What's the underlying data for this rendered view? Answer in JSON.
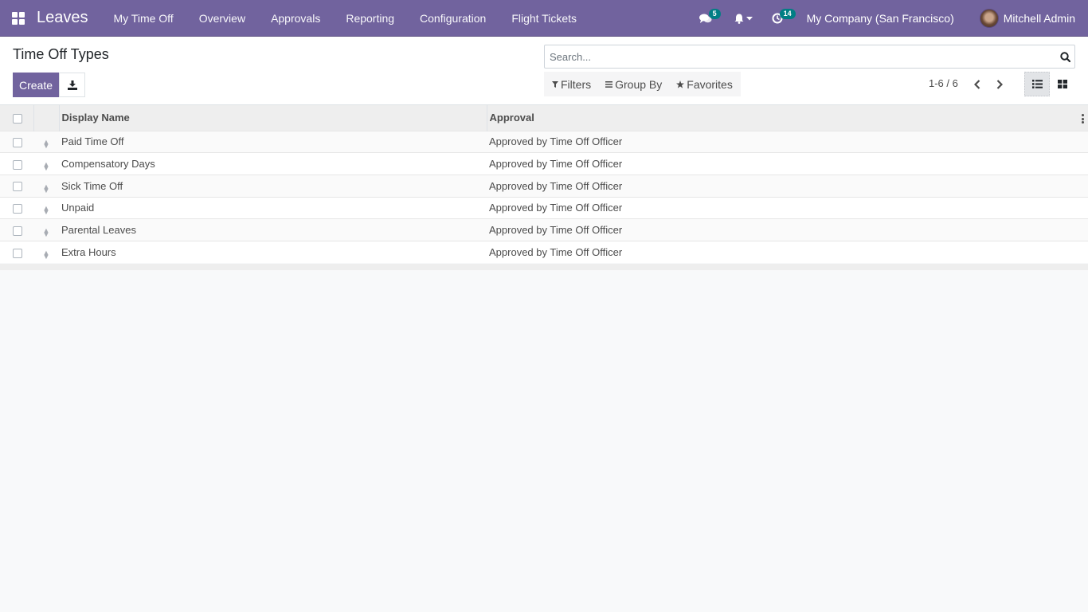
{
  "navbar": {
    "app_name": "Leaves",
    "menu": [
      "My Time Off",
      "Overview",
      "Approvals",
      "Reporting",
      "Configuration",
      "Flight Tickets"
    ],
    "messages_count": "5",
    "activities_count": "14",
    "company": "My Company (San Francisco)",
    "user": "Mitchell Admin"
  },
  "control_panel": {
    "title": "Time Off Types",
    "create_label": "Create",
    "search_placeholder": "Search...",
    "search_value": "",
    "filters_label": "Filters",
    "group_by_label": "Group By",
    "favorites_label": "Favorites",
    "pager": "1-6 / 6",
    "active_view": "list"
  },
  "table": {
    "columns": [
      "Display Name",
      "Approval"
    ],
    "rows": [
      {
        "name": "Paid Time Off",
        "approval": "Approved by Time Off Officer"
      },
      {
        "name": "Compensatory Days",
        "approval": "Approved by Time Off Officer"
      },
      {
        "name": "Sick Time Off",
        "approval": "Approved by Time Off Officer"
      },
      {
        "name": "Unpaid",
        "approval": "Approved by Time Off Officer"
      },
      {
        "name": "Parental Leaves",
        "approval": "Approved by Time Off Officer"
      },
      {
        "name": "Extra Hours",
        "approval": "Approved by Time Off Officer"
      }
    ]
  },
  "colors": {
    "brand": "#71639e",
    "badge": "#017e84"
  }
}
